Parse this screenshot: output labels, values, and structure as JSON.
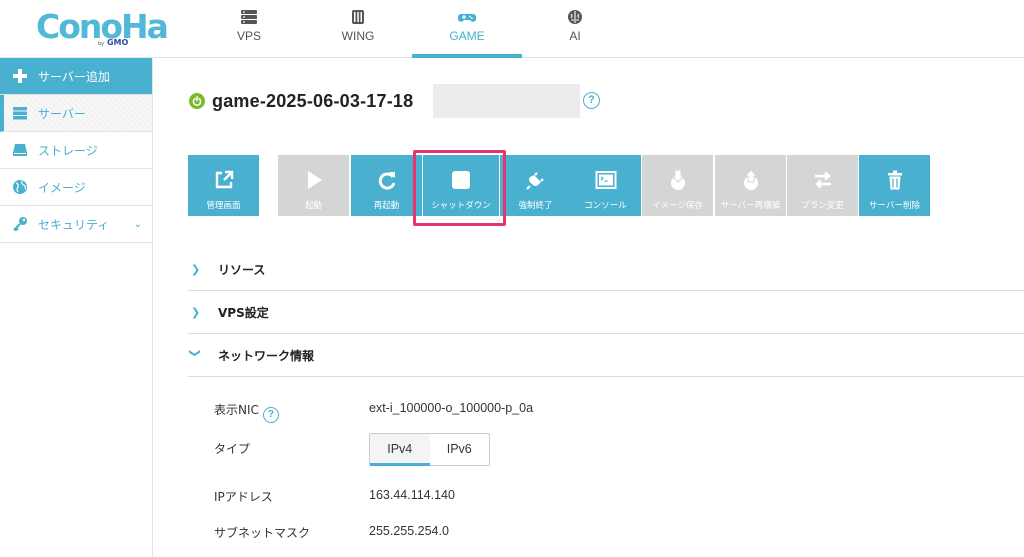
{
  "brand": {
    "logo_text": "ConoHa",
    "logo_by": "by",
    "logo_gmo": "GMO"
  },
  "nav": {
    "tabs": [
      {
        "label": "VPS",
        "icon": "server-icon"
      },
      {
        "label": "WING",
        "icon": "wing-icon"
      },
      {
        "label": "GAME",
        "icon": "gamepad-icon",
        "active": true
      },
      {
        "label": "AI",
        "icon": "ai-brain-icon"
      }
    ]
  },
  "sidebar": {
    "items": [
      {
        "label": "サーバー追加",
        "icon": "plus-icon"
      },
      {
        "label": "サーバー",
        "icon": "server-icon",
        "active": true
      },
      {
        "label": "ストレージ",
        "icon": "storage-icon"
      },
      {
        "label": "イメージ",
        "icon": "globe-icon"
      },
      {
        "label": "セキュリティ",
        "icon": "key-icon",
        "expandable": true
      }
    ]
  },
  "server": {
    "name": "game-2025-06-03-17-18",
    "status_icon": "power-icon",
    "status_color": "#7ab82e",
    "help": "?"
  },
  "toolbar": {
    "buttons": [
      {
        "label": "管理画面",
        "icon": "external-link-icon",
        "enabled": true
      },
      {
        "label": "起動",
        "icon": "play-icon",
        "enabled": false
      },
      {
        "label": "再起動",
        "icon": "restart-icon",
        "enabled": true
      },
      {
        "label": "シャットダウン",
        "icon": "stop-icon",
        "enabled": true,
        "highlighted": true
      },
      {
        "label": "強制終了",
        "icon": "plug-icon",
        "enabled": true
      },
      {
        "label": "コンソール",
        "icon": "console-icon",
        "enabled": true
      },
      {
        "label": "イメージ保存",
        "icon": "image-save-icon",
        "enabled": false
      },
      {
        "label": "サーバー再構築",
        "icon": "rebuild-icon",
        "enabled": false
      },
      {
        "label": "プラン変更",
        "icon": "swap-icon",
        "enabled": false
      },
      {
        "label": "サーバー削除",
        "icon": "trash-icon",
        "enabled": true
      }
    ]
  },
  "sections": [
    {
      "title": "リソース",
      "expanded": false
    },
    {
      "title": "VPS設定",
      "expanded": false
    },
    {
      "title": "ネットワーク情報",
      "expanded": true
    }
  ],
  "network": {
    "nic_label": "表示NIC",
    "nic_help": "?",
    "nic_value": "ext-i_100000-o_100000-p_0a",
    "type_label": "タイプ",
    "type_options": [
      "IPv4",
      "IPv6"
    ],
    "type_selected": "IPv4",
    "ip_label": "IPアドレス",
    "ip_value": "163.44.114.140",
    "mask_label": "サブネットマスク",
    "mask_value": "255.255.254.0"
  },
  "colors": {
    "accent": "#4ab0cf",
    "disabled": "#d5d5d5",
    "highlight": "#e8336e"
  }
}
